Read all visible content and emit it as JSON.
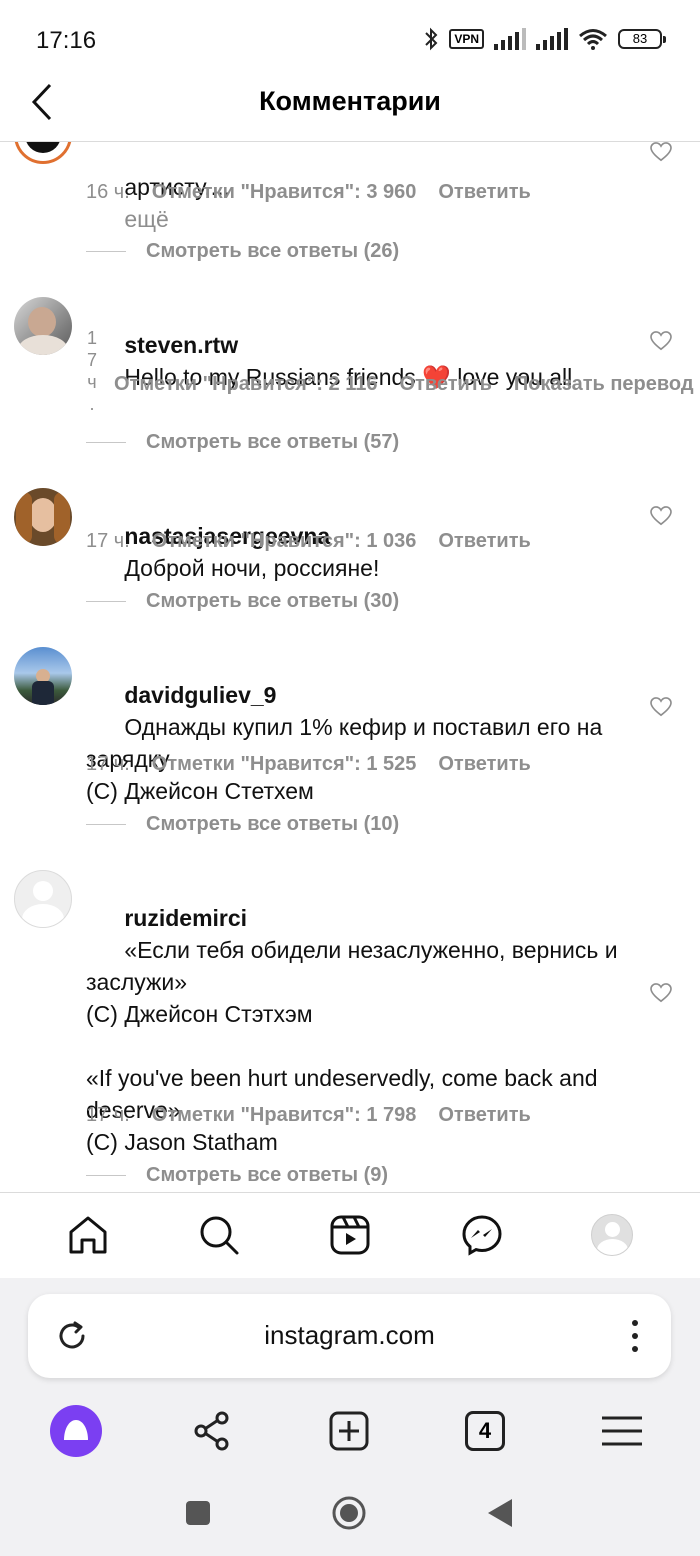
{
  "status_bar": {
    "time": "17:16",
    "vpn": "VPN",
    "battery": "83"
  },
  "header": {
    "title": "Комментарии"
  },
  "comments": [
    {
      "user": "",
      "text": "артисту,...",
      "more": "ещё",
      "time": "16 ч.",
      "likes": "Отметки \"Нравится\": 3 960",
      "reply": "Ответить",
      "view_replies": "Смотреть все ответы (26)"
    },
    {
      "user": "steven.rtw",
      "text": "Hello to my Russians friends ❤️ love you all",
      "time_chars": [
        "1",
        "7",
        "ч",
        "."
      ],
      "likes": "Отметки \"Нравится\": 2 116",
      "reply": "Ответить",
      "translate": "Показать перевод",
      "view_replies": "Смотреть все ответы (57)"
    },
    {
      "user": "nastasjasergeevna",
      "text": "Доброй ночи, россияне!",
      "time": "17 ч.",
      "likes": "Отметки \"Нравится\": 1 036",
      "reply": "Ответить",
      "view_replies": "Смотреть все ответы (30)"
    },
    {
      "user": "davidguliev_9",
      "text": "Однажды купил 1% кефир и поставил его на зарядку\n(C) Джейсон Стетхем",
      "time": "17 ч.",
      "likes": "Отметки \"Нравится\": 1 525",
      "reply": "Ответить",
      "view_replies": "Смотреть все ответы (10)"
    },
    {
      "user": "ruzidemirci",
      "text": "«Если тебя обидели незаслуженно, вернись и заслужи»\n(C) Джейсон Стэтхэм\n\n«If you've been hurt undeservedly, come back and deserve»\n(C) Jason Statham",
      "time": "17 ч.",
      "likes": "Отметки \"Нравится\": 1 798",
      "reply": "Ответить",
      "view_replies": "Смотреть все ответы (9)"
    }
  ],
  "ig_nav": [
    "home-icon",
    "search-icon",
    "reels-icon",
    "messenger-icon",
    "profile-avatar"
  ],
  "browser": {
    "url": "instagram.com",
    "tabs_count": "4"
  },
  "colors": {
    "muted": "#8e8e8e",
    "alice": "#7b3ff2",
    "heart": "#e0245e"
  }
}
